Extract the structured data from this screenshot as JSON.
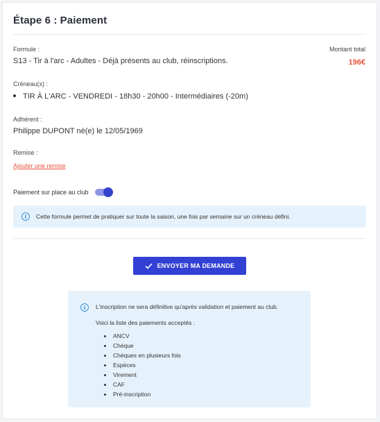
{
  "step_title": "Étape 6 : Paiement",
  "formule": {
    "label": "Formule :",
    "value": "S13 - Tir à l'arc - Adultes - Déjà présents au club, réinscriptions."
  },
  "total": {
    "label": "Montant total",
    "amount": "196€"
  },
  "creneaux": {
    "label": "Créneau(x) :",
    "items": [
      "TIR À L'ARC - VENDREDI - 18h30 - 20h00 - Intermédiaires (-20m)"
    ]
  },
  "adherent": {
    "label": "Adhérent :",
    "value": "Philippe DUPONT né(e) le 12/05/1969"
  },
  "remise": {
    "label": "Remise :",
    "link": "Ajouter une remise"
  },
  "payment_on_site": {
    "label": "Paiement sur place au club",
    "enabled": true
  },
  "info_message": "Cette formule permet de pratiquer sur toute la saison, une fois par semaine sur un créneau défini.",
  "submit_label": "ENVOYER MA DEMANDE",
  "notice": {
    "text": "L'inscription ne sera définitive qu'après validation et paiement au club.",
    "list_intro": "Voici la liste des paiements acceptés :",
    "methods": [
      "ANCV",
      "Chèque",
      "Chèques en plusieurs fois",
      "Espèces",
      "Virement",
      "CAF",
      "Pré-inscription"
    ]
  },
  "colors": {
    "accent": "#3340d4",
    "price": "#e5533d",
    "info_bg": "#e6f2fb",
    "info_icon": "#3a8fd6"
  },
  "icons": {
    "info": "info-circle-icon",
    "submit": "check-icon"
  }
}
